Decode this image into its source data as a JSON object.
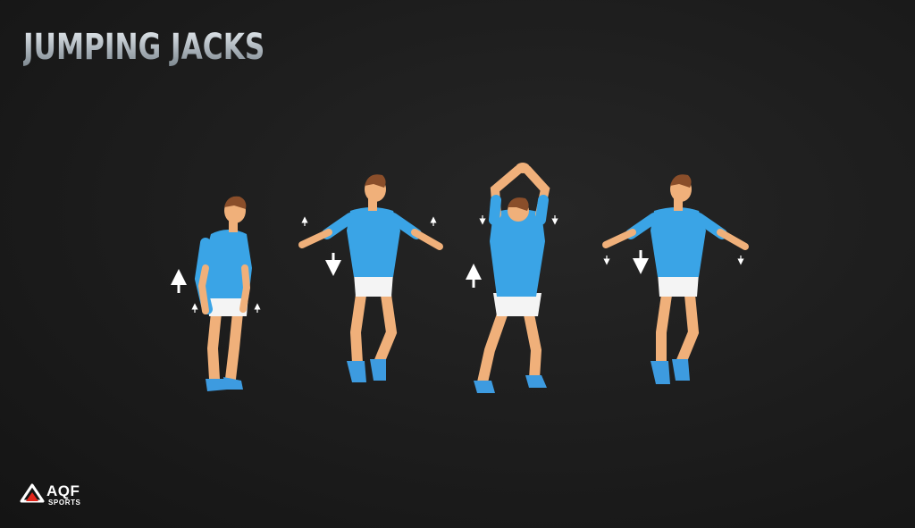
{
  "title": "JUMPING JACKS",
  "logo": {
    "wordmark": "AQF",
    "tagline": "SPORTS"
  },
  "figures": [
    {
      "name": "figure-standing",
      "phase": "start",
      "arrow": "up"
    },
    {
      "name": "figure-arms-out-landing",
      "phase": "mid-down",
      "arrow": "down"
    },
    {
      "name": "figure-arms-overhead",
      "phase": "top",
      "arrow": "up"
    },
    {
      "name": "figure-arms-out-return",
      "phase": "return",
      "arrow": "down"
    }
  ],
  "colors": {
    "background": "#1b1b1b",
    "shirt": "#3aa4e6",
    "shorts": "#f4f4f4",
    "skin": "#f0b07a",
    "shoes": "#3d9be0",
    "hair": "#8a4e2a",
    "arrow": "#ffffff",
    "logo_red": "#e1251b"
  }
}
